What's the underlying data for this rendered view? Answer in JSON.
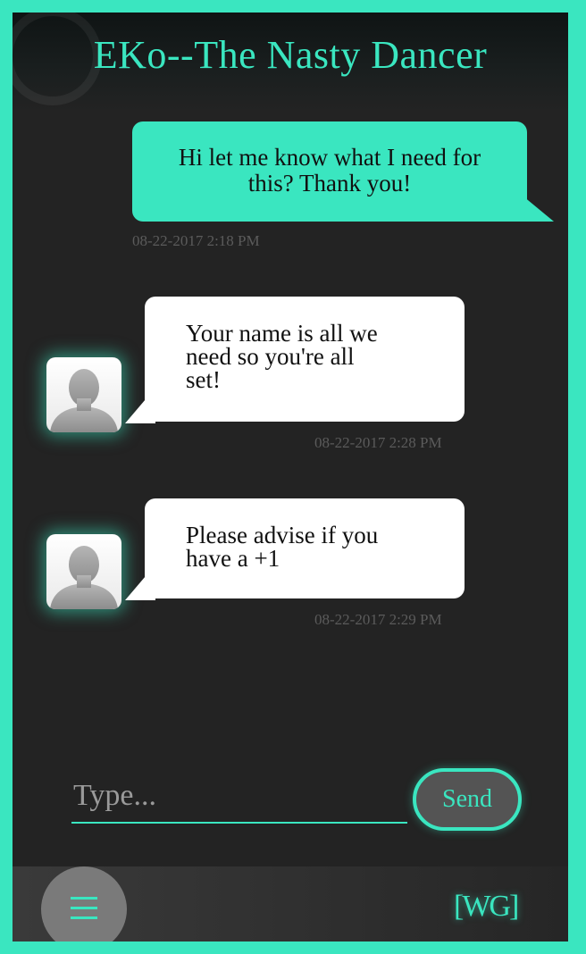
{
  "header": {
    "title": "EKo--The Nasty Dancer"
  },
  "messages": [
    {
      "direction": "outgoing",
      "text": "Hi let me know what I need for this? Thank you!",
      "timestamp": "08-22-2017 2:18 PM"
    },
    {
      "direction": "incoming",
      "text_lines": [
        "Your name is all we",
        "need so you're all",
        "set!"
      ],
      "timestamp": "08-22-2017 2:28 PM",
      "avatar": "user-silhouette-icon"
    },
    {
      "direction": "incoming",
      "text_lines": [
        "Please advise if you",
        "have a +1"
      ],
      "timestamp": "08-22-2017 2:29 PM",
      "avatar": "user-silhouette-icon"
    }
  ],
  "composer": {
    "placeholder": "Type...",
    "send_label": "Send"
  },
  "footer": {
    "menu_icon": "hamburger-menu-icon",
    "logo_text": "[WG]"
  },
  "colors": {
    "accent": "#3ae6c0",
    "background": "#232323",
    "incoming_bubble": "#ffffff"
  }
}
